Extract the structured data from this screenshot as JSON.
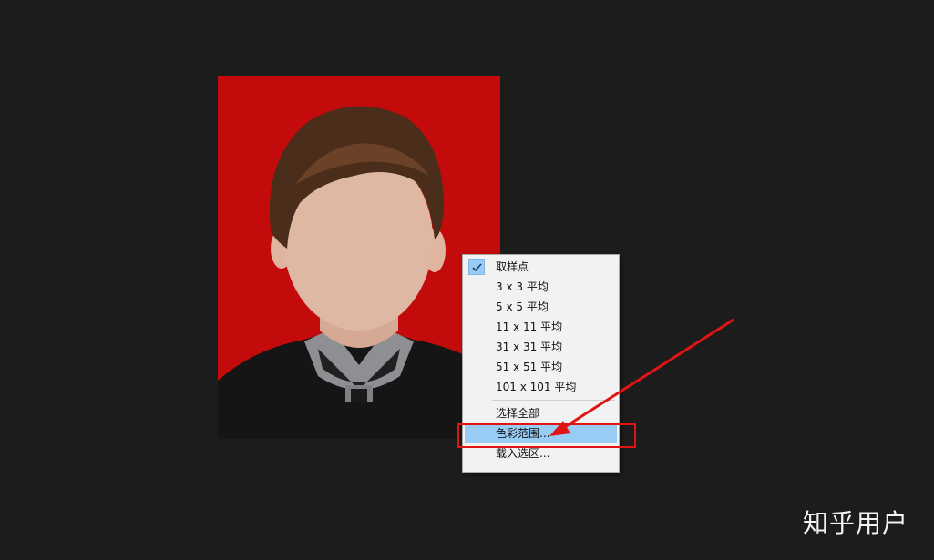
{
  "context_menu": {
    "items": [
      {
        "label": "取样点",
        "checked": true
      },
      {
        "label": "3 x 3 平均"
      },
      {
        "label": "5 x 5 平均"
      },
      {
        "label": "11 x 11 平均"
      },
      {
        "label": "31 x 31 平均"
      },
      {
        "label": "51 x 51 平均"
      },
      {
        "label": "101 x 101 平均"
      }
    ],
    "items_after_separator": [
      {
        "label": "选择全部"
      },
      {
        "label": "色彩范围...",
        "highlighted": true
      },
      {
        "label": "载入选区..."
      }
    ]
  },
  "watermark": "知乎用户",
  "colors": {
    "photo_background": "#c40b0b",
    "menu_highlight": "#99ccf5",
    "annotation_red": "#e01414",
    "canvas_background": "#1c1c1c"
  },
  "icons": {
    "check": "check-icon"
  }
}
